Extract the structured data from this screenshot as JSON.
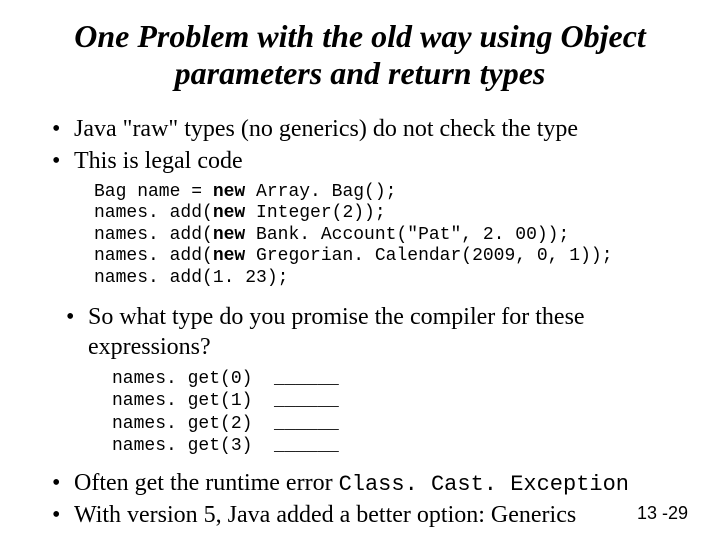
{
  "title": "One Problem with the old way using Object parameters and return types",
  "bullets1": {
    "b1": "Java \"raw\" types (no generics) do not check the type",
    "b2": "This is legal code"
  },
  "code1": {
    "kw_new": "new",
    "l1_a": "Bag name = ",
    "l1_b": " Array. Bag();",
    "l2_a": "names. add(",
    "l2_b": " Integer(2));",
    "l3_a": "names. add(",
    "l3_b": " Bank. Account(\"Pat\", 2. 00));",
    "l4_a": "names. add(",
    "l4_b": " Gregorian. Calendar(2009, 0, 1));",
    "l5": "names. add(1. 23);"
  },
  "bullets2": {
    "b1": "So what type do you promise the compiler for these expressions?"
  },
  "code2": {
    "l1": "names. get(0)  ______",
    "l2": "names. get(1)  ______",
    "l3": "names. get(2)  ______",
    "l4": "names. get(3)  ______"
  },
  "bullets3": {
    "b1_a": "Often get the runtime error ",
    "b1_b": "Class. Cast. Exception",
    "b2": "With version 5, Java added a better option: Generics"
  },
  "pagenum": "13 -29"
}
